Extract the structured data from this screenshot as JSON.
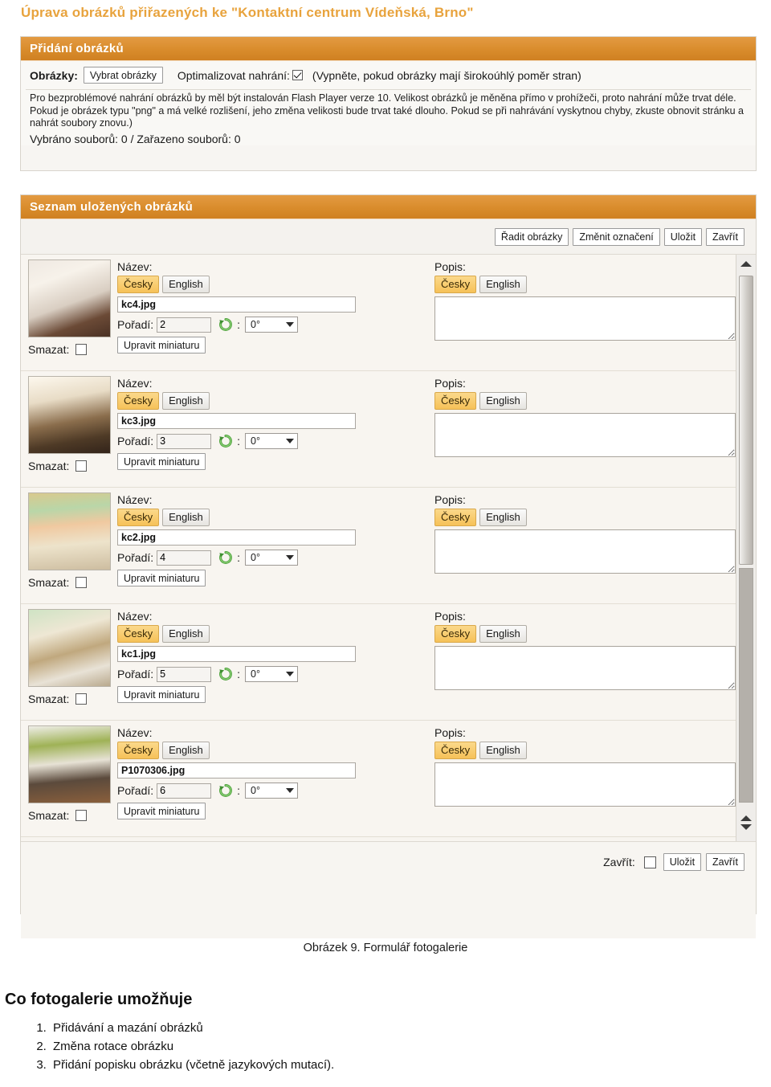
{
  "page": {
    "title": "Úprava obrázků přiřazených ke \"Kontaktní centrum Vídeňská, Brno\"",
    "caption": "Obrázek 9. Formulář fotogalerie",
    "doc_heading": "Co fotogalerie umožňuje",
    "doc_list": [
      "Přidávání a mazání obrázků",
      "Změna rotace obrázku",
      "Přidání popisku obrázku (včetně jazykových mutací)."
    ]
  },
  "upload_panel": {
    "header": "Přidání obrázků",
    "images_label": "Obrázky:",
    "select_button": "Vybrat obrázky",
    "optimize_label": "Optimalizovat nahrání:",
    "optimize_checked": true,
    "optimize_note": "(Vypněte, pokud obrázky mají širokoúhlý poměr stran)",
    "help_text": "Pro bezproblémové nahrání obrázků by měl být instalován Flash Player verze 10. Velikost obrázků je měněna přímo v prohížeči, proto nahrání může trvat déle. Pokud je obrázek typu \"png\" a má velké rozlišení, jeho změna velikosti bude trvat také dlouho. Pokud se při nahrávání vyskytnou chyby, zkuste obnovit stránku a nahrát soubory znovu.)",
    "counts": "Vybráno souborů: 0 / Zařazeno souborů: 0"
  },
  "list_panel": {
    "header": "Seznam uložených obrázků",
    "toolbar": {
      "sort": "Řadit obrázky",
      "rename": "Změnit označení",
      "save": "Uložit",
      "close": "Zavřít"
    },
    "labels": {
      "name": "Název:",
      "description": "Popis:",
      "order": "Pořadí:",
      "delete": "Smazat:",
      "edit_thumb": "Upravit miniaturu",
      "lang_cs": "Česky",
      "lang_en": "English",
      "colon": ":"
    },
    "rows": [
      {
        "filename": "kc4.jpg",
        "order": "2",
        "rotation": "0°",
        "delete_checked": false,
        "description": "",
        "active_lang": "Česky"
      },
      {
        "filename": "kc3.jpg",
        "order": "3",
        "rotation": "0°",
        "delete_checked": false,
        "description": "",
        "active_lang": "Česky"
      },
      {
        "filename": "kc2.jpg",
        "order": "4",
        "rotation": "0°",
        "delete_checked": false,
        "description": "",
        "active_lang": "Česky"
      },
      {
        "filename": "kc1.jpg",
        "order": "5",
        "rotation": "0°",
        "delete_checked": false,
        "description": "",
        "active_lang": "Česky"
      },
      {
        "filename": "P1070306.jpg",
        "order": "6",
        "rotation": "0°",
        "delete_checked": false,
        "description": "",
        "active_lang": "Česky"
      }
    ],
    "footer": {
      "close_label": "Zavřít:",
      "close_checked": false,
      "save": "Uložit",
      "close": "Zavřít"
    }
  },
  "colors": {
    "accent_orange": "#d98c2c",
    "title_orange": "#e8a33d",
    "tab_active": "#f6c158",
    "panel_bg": "#f7f5f2"
  }
}
